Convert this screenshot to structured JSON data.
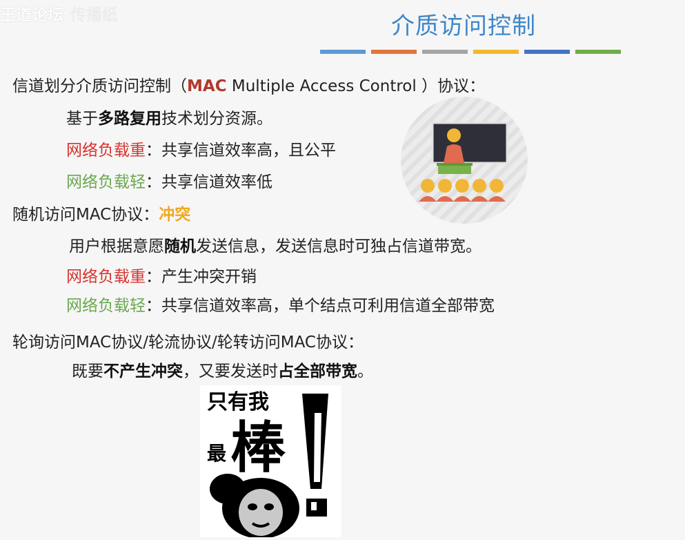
{
  "watermark": {
    "main": "王道论坛",
    "faint": "传播纸"
  },
  "title": "介质访问控制",
  "color_bar": [
    "#5b9bd5",
    "#e0763a",
    "#a5a5a5",
    "#f3b82e",
    "#4472c4",
    "#70ad47"
  ],
  "section1": {
    "prefix": "信道划分介质访问控制（",
    "mac": "MAC",
    "eng": " Multiple Access Control ）",
    "suffix": "协议：",
    "l1_pre": "基于",
    "l1_bold": "多路复用",
    "l1_post": "技术划分资源。",
    "l2_label": "网络负载重",
    "l2_text": "：共享信道效率高，且公平",
    "l3_label": "网络负载轻",
    "l3_text": "：共享信道效率低"
  },
  "section2": {
    "head": "随机访问MAC协议：",
    "head_tag": "冲突",
    "l1_pre": "用户根据意愿",
    "l1_bold": "随机",
    "l1_post": "发送信息，发送信息时可独占信道带宽。",
    "l2_label": "网络负载重",
    "l2_text": "：产生冲突开销",
    "l3_label": "网络负载轻",
    "l3_text": "：共享信道效率高，单个结点可利用信道全部带宽"
  },
  "section3": {
    "head": "轮询访问MAC协议/轮流协议/轮转访问MAC协议：",
    "l1_pre": "既要",
    "l1_bold": "不产生冲突",
    "l1_mid": "，又要发送时",
    "l1_bold2": "占全部带宽",
    "l1_post": "。"
  },
  "meme": {
    "line1": "只有我",
    "small": "最",
    "big": "棒"
  }
}
